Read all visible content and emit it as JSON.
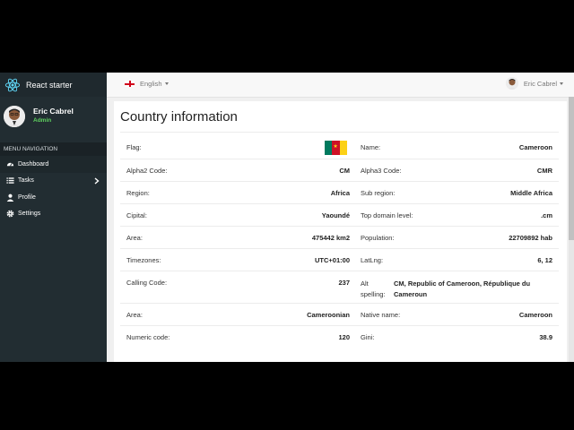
{
  "sidebar": {
    "brand": "React starter",
    "user_name": "Eric Cabrel",
    "user_role": "Admin",
    "menu_header": "MENU NAVIGATION",
    "items": [
      {
        "label": "Dashboard",
        "icon": "dashboard-icon"
      },
      {
        "label": "Tasks",
        "icon": "tasks-icon"
      },
      {
        "label": "Profile",
        "icon": "user-icon"
      },
      {
        "label": "Settings",
        "icon": "gear-icon"
      }
    ]
  },
  "topbar": {
    "language": "English",
    "user": "Eric Cabrel"
  },
  "page": {
    "title": "Country information"
  },
  "country": {
    "left": [
      {
        "label": "Flag:",
        "value": ""
      },
      {
        "label": "Alpha2 Code:",
        "value": "CM"
      },
      {
        "label": "Region:",
        "value": "Africa"
      },
      {
        "label": "Cipital:",
        "value": "Yaoundé"
      },
      {
        "label": "Area:",
        "value": "475442 km2"
      },
      {
        "label": "Timezones:",
        "value": "UTC+01:00"
      },
      {
        "label": "Calling Code:",
        "value": "237"
      },
      {
        "label": "Area:",
        "value": "Cameroonian"
      },
      {
        "label": "Numeric code:",
        "value": "120"
      }
    ],
    "right": [
      {
        "label": "Name:",
        "value": "Cameroon"
      },
      {
        "label": "Alpha3 Code:",
        "value": "CMR"
      },
      {
        "label": "Sub region:",
        "value": "Middle Africa"
      },
      {
        "label": "Top domain level:",
        "value": ".cm"
      },
      {
        "label": "Population:",
        "value": "22709892 hab"
      },
      {
        "label": "LatLng:",
        "value": "6, 12"
      },
      {
        "label": "Alt spelling:",
        "value": "CM, Republic of Cameroon, République du Cameroun"
      },
      {
        "label": "Native name:",
        "value": "Cameroon"
      },
      {
        "label": "Gini:",
        "value": "38.9"
      }
    ],
    "flag_colors": [
      "#007a5e",
      "#ce1126",
      "#fcd116"
    ]
  },
  "colors": {
    "sidebar_bg": "#222d32",
    "accent_green": "#5fd15f"
  }
}
